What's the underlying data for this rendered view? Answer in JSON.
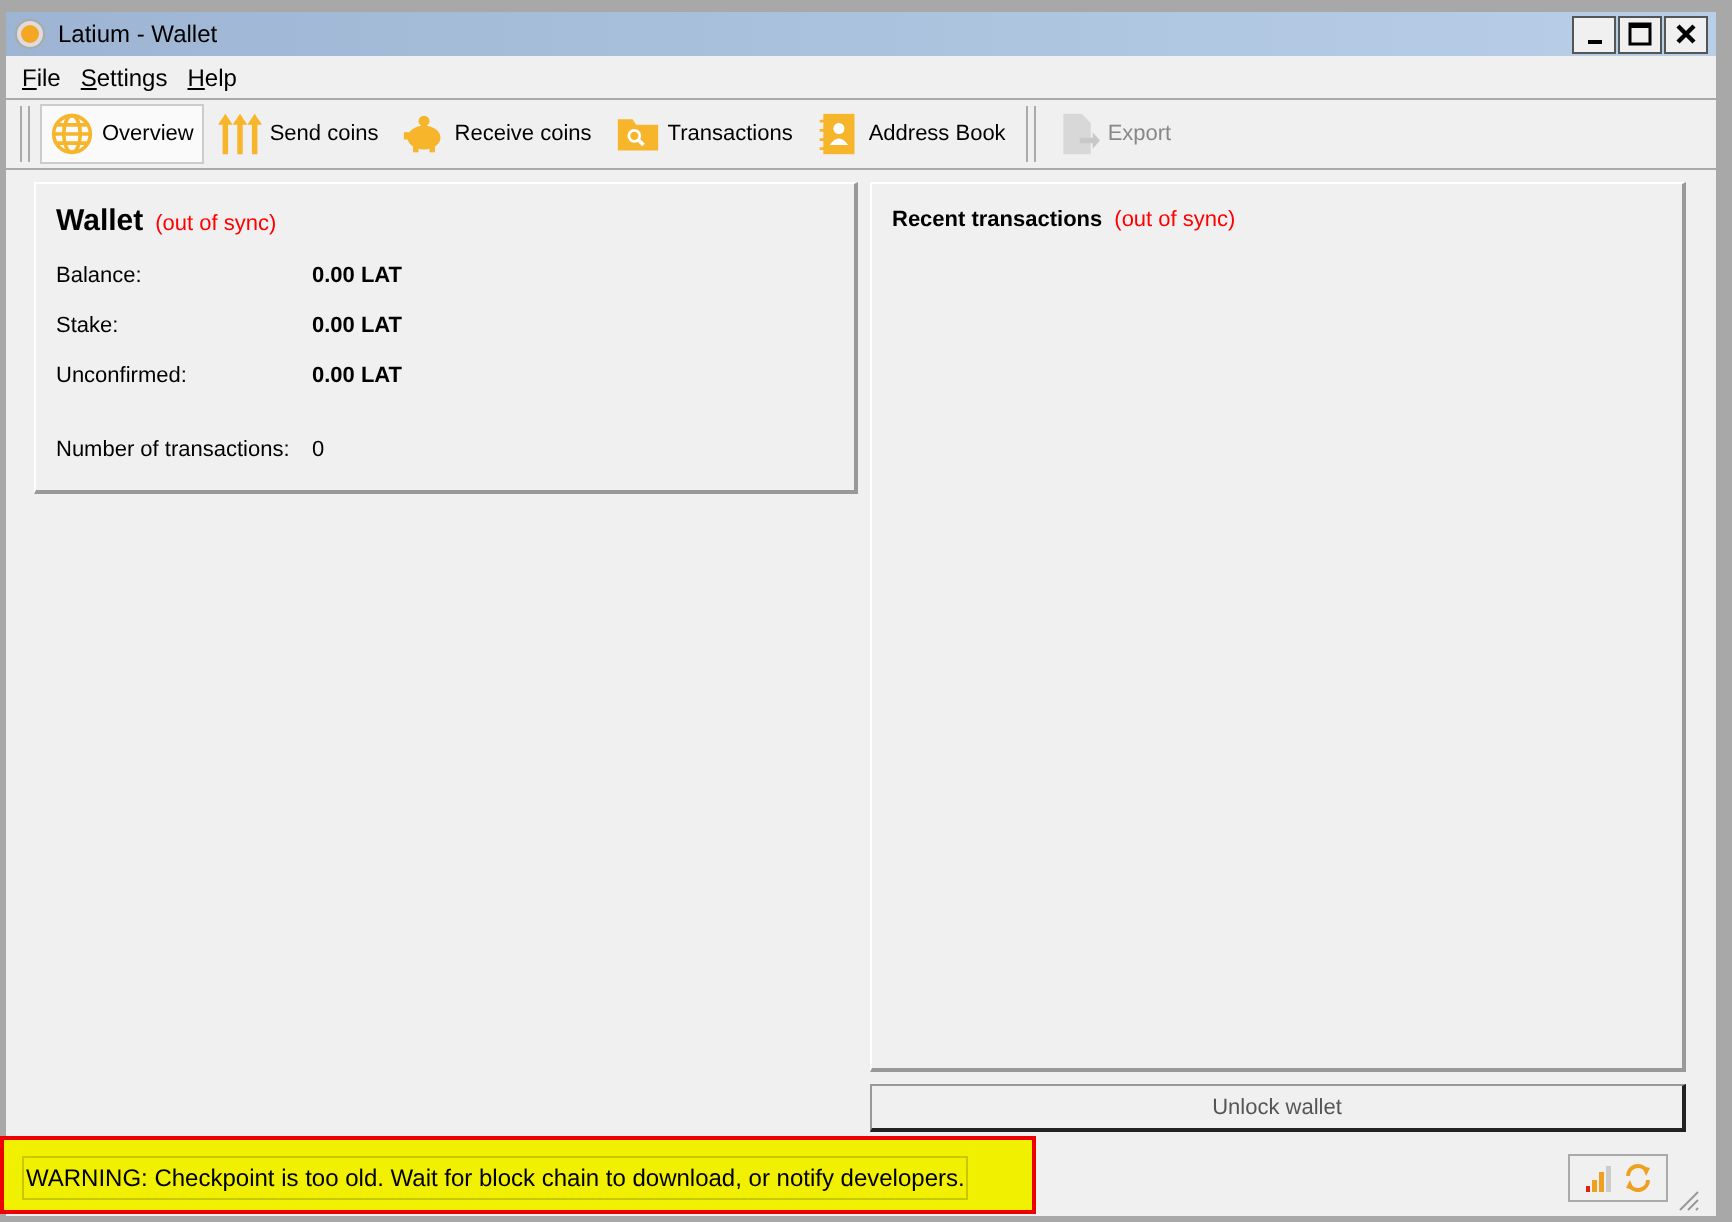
{
  "window": {
    "title": "Latium - Wallet"
  },
  "menu": [
    {
      "label": "File"
    },
    {
      "label": "Settings"
    },
    {
      "label": "Help"
    }
  ],
  "toolbar": [
    {
      "label": "Overview",
      "selected": true,
      "disabled": false
    },
    {
      "label": "Send coins",
      "selected": false,
      "disabled": false
    },
    {
      "label": "Receive coins",
      "selected": false,
      "disabled": false
    },
    {
      "label": "Transactions",
      "selected": false,
      "disabled": false
    },
    {
      "label": "Address Book",
      "selected": false,
      "disabled": false
    },
    {
      "label": "Export",
      "selected": false,
      "disabled": true
    }
  ],
  "wallet": {
    "title": "Wallet",
    "sync_status": "(out of sync)",
    "rows": [
      {
        "label": "Balance:",
        "value": "0.00 LAT"
      },
      {
        "label": "Stake:",
        "value": "0.00 LAT"
      },
      {
        "label": "Unconfirmed:",
        "value": "0.00 LAT"
      }
    ],
    "transactions_count": {
      "label": "Number of transactions:",
      "value": "0"
    }
  },
  "recent": {
    "title": "Recent transactions",
    "sync_status": "(out of sync)"
  },
  "unlock_button": "Unlock wallet",
  "status_bar": {
    "message": "WARNING: Checkpoint is too old. Wait for block chain to download, or notify developers."
  }
}
